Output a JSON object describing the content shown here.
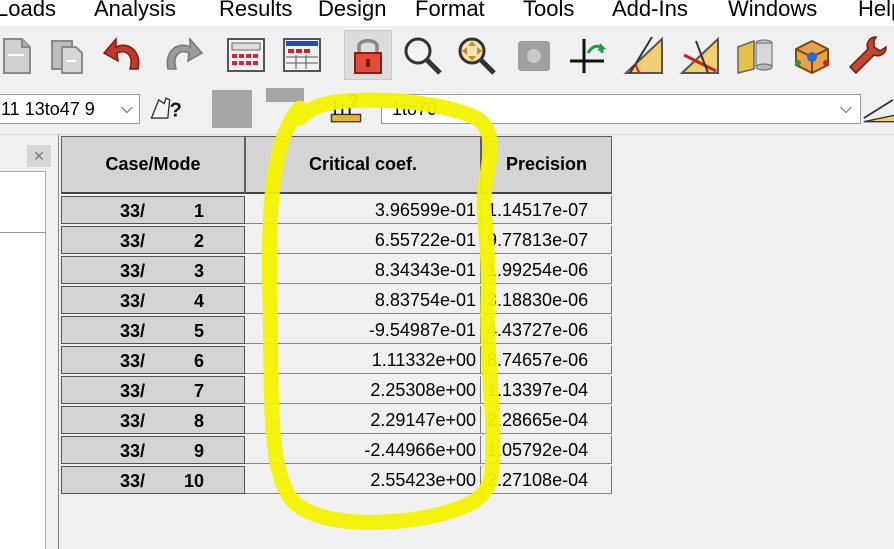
{
  "menubar": {
    "items": [
      "Loads",
      "Analysis",
      "Results",
      "Design",
      "Format",
      "Tools",
      "Add-Ins",
      "Windows",
      "Help"
    ]
  },
  "toolbar": {
    "icons": [
      "new-page-icon",
      "paste-page-icon",
      "undo-icon",
      "redo-icon",
      "calculator-icon",
      "calculation-table-icon",
      "lock-icon",
      "zoom-icon",
      "pan-icon",
      "view-dim-icon",
      "axis-icon",
      "measure-angle-icon",
      "section-view-icon",
      "structure-icon",
      "3d-view-icon",
      "wrench-icon"
    ],
    "left_combo_value": "11 13to47 9",
    "right_combo_value": "1to70",
    "help_cursor_icon": "help-cursor-icon",
    "load-selection-icon": "load-selection-icon"
  },
  "panel": {
    "close_label": "×"
  },
  "table": {
    "headers": {
      "case_mode": "Case/Mode",
      "critical": "Critical coef.",
      "precision": "Precision"
    },
    "rows": [
      {
        "case": "33/",
        "mode": "1",
        "coef": "3.96599e-01",
        "precision": "1.14517e-07"
      },
      {
        "case": "33/",
        "mode": "2",
        "coef": "6.55722e-01",
        "precision": "9.77813e-07"
      },
      {
        "case": "33/",
        "mode": "3",
        "coef": "8.34343e-01",
        "precision": "1.99254e-06"
      },
      {
        "case": "33/",
        "mode": "4",
        "coef": "8.83754e-01",
        "precision": "3.18830e-06"
      },
      {
        "case": "33/",
        "mode": "5",
        "coef": "-9.54987e-01",
        "precision": "4.43727e-06"
      },
      {
        "case": "33/",
        "mode": "6",
        "coef": "1.11332e+00",
        "precision": "8.74657e-06"
      },
      {
        "case": "33/",
        "mode": "7",
        "coef": "2.25308e+00",
        "precision": "1.13397e-04"
      },
      {
        "case": "33/",
        "mode": "8",
        "coef": "2.29147e+00",
        "precision": "2.28665e-04"
      },
      {
        "case": "33/",
        "mode": "9",
        "coef": "-2.44966e+00",
        "precision": "1.05792e-04"
      },
      {
        "case": "33/",
        "mode": "10",
        "coef": "2.55423e+00",
        "precision": "2.27108e-04"
      }
    ]
  },
  "colors": {
    "highlight": "#f2f200",
    "header_bg": "#d4d4d4",
    "window_bg": "#f0f0f0"
  }
}
